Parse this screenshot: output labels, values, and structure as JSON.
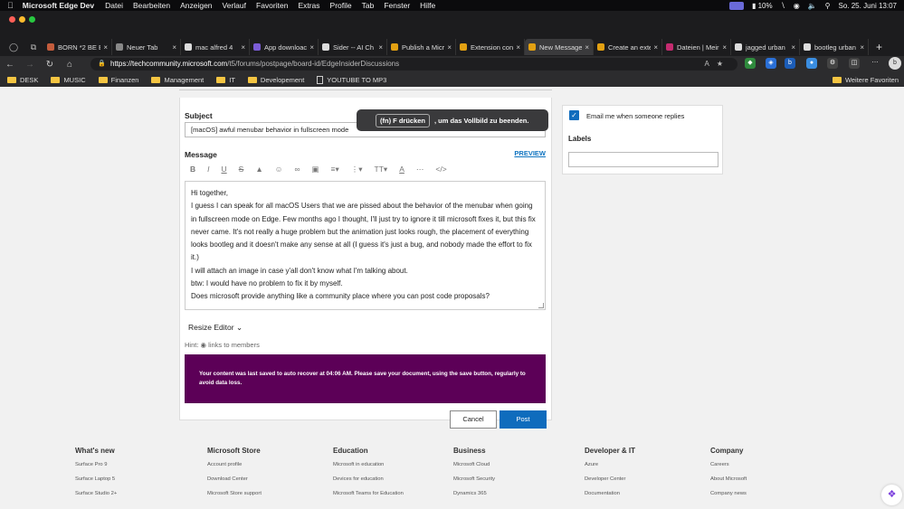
{
  "menubar": {
    "app_name": "Microsoft Edge Dev",
    "items": [
      "Datei",
      "Bearbeiten",
      "Anzeigen",
      "Verlauf",
      "Favoriten",
      "Extras",
      "Profile",
      "Tab",
      "Fenster",
      "Hilfe"
    ],
    "battery": "10%",
    "datetime": "So. 25. Juni  13:07"
  },
  "tabs": [
    {
      "label": "BORN *2 BE B",
      "color": "#c45c3c"
    },
    {
      "label": "Neuer Tab",
      "color": "#888888"
    },
    {
      "label": "mac alfred 4",
      "color": "#dddddd"
    },
    {
      "label": "App downloac",
      "color": "#7b5cd6"
    },
    {
      "label": "Sider -- AI Ch",
      "color": "#dddddd"
    },
    {
      "label": "Publish a Micr",
      "color": "#e2a012"
    },
    {
      "label": "Extension con",
      "color": "#e2a012"
    },
    {
      "label": "New Message",
      "color": "#e2a012",
      "active": true
    },
    {
      "label": "Create an exte",
      "color": "#e2a012"
    },
    {
      "label": "Dateien | Meir",
      "color": "#c42b6f"
    },
    {
      "label": "jagged urban",
      "color": "#dddddd"
    },
    {
      "label": "bootleg urban",
      "color": "#dddddd"
    }
  ],
  "address": {
    "host": "https://techcommunity.microsoft.com",
    "path": "/t5/forums/postpage/board-id/EdgeInsiderDiscussions"
  },
  "bookmarks": [
    "DESK",
    "MUSIC",
    "Finanzen",
    "Management",
    "IT",
    "Developement",
    "YOUTUBE TO MP3"
  ],
  "bookmarks_right": "Weitere Favoriten",
  "toast": {
    "key": "(fn) F drücken",
    "text": ", um das Vollbild zu beenden."
  },
  "form": {
    "subject_label": "Subject",
    "subject_value": "[macOS] awful menubar behavior in fullscreen mode",
    "message_label": "Message",
    "preview": "PREVIEW",
    "body": [
      "Hi together,",
      "I guess I can speak for all macOS Users that we are pissed about the behavior of the menubar when going in fullscreen mode on Edge. Few months ago I thought, I'll just try to ignore it till microsoft fixes it, but this fix never came. It's not really a huge problem but the animation just looks rough, the placement of everything looks bootleg and it doesn't make any sense at all (I guess it's just a bug, and nobody made the effort to fix it.)",
      "I will attach an image in case y'all don't know what I'm talking about.",
      "btw: I would have no problem to fix it by myself.",
      "Does microsoft provide anything like a community place where you can post code proposals?"
    ],
    "resize_editor": "Resize Editor",
    "hint_label": "Hint:",
    "hint_text": "links to members",
    "autosave_notice": "Your content was last saved to auto recover at 04:06 AM. Please save your document, using the save button, regularly to avoid data loss.",
    "cancel": "Cancel",
    "post": "Post"
  },
  "sidebar": {
    "email_label": "Email me when someone replies",
    "labels_label": "Labels"
  },
  "footer": [
    {
      "heading": "What's new",
      "links": [
        "Surface Pro 9",
        "Surface Laptop 5",
        "Surface Studio 2+"
      ]
    },
    {
      "heading": "Microsoft Store",
      "links": [
        "Account profile",
        "Download Center",
        "Microsoft Store support"
      ]
    },
    {
      "heading": "Education",
      "links": [
        "Microsoft in education",
        "Devices for education",
        "Microsoft Teams for Education"
      ]
    },
    {
      "heading": "Business",
      "links": [
        "Microsoft Cloud",
        "Microsoft Security",
        "Dynamics 365"
      ]
    },
    {
      "heading": "Developer & IT",
      "links": [
        "Azure",
        "Developer Center",
        "Documentation"
      ]
    },
    {
      "heading": "Company",
      "links": [
        "Careers",
        "About Microsoft",
        "Company news"
      ]
    }
  ]
}
